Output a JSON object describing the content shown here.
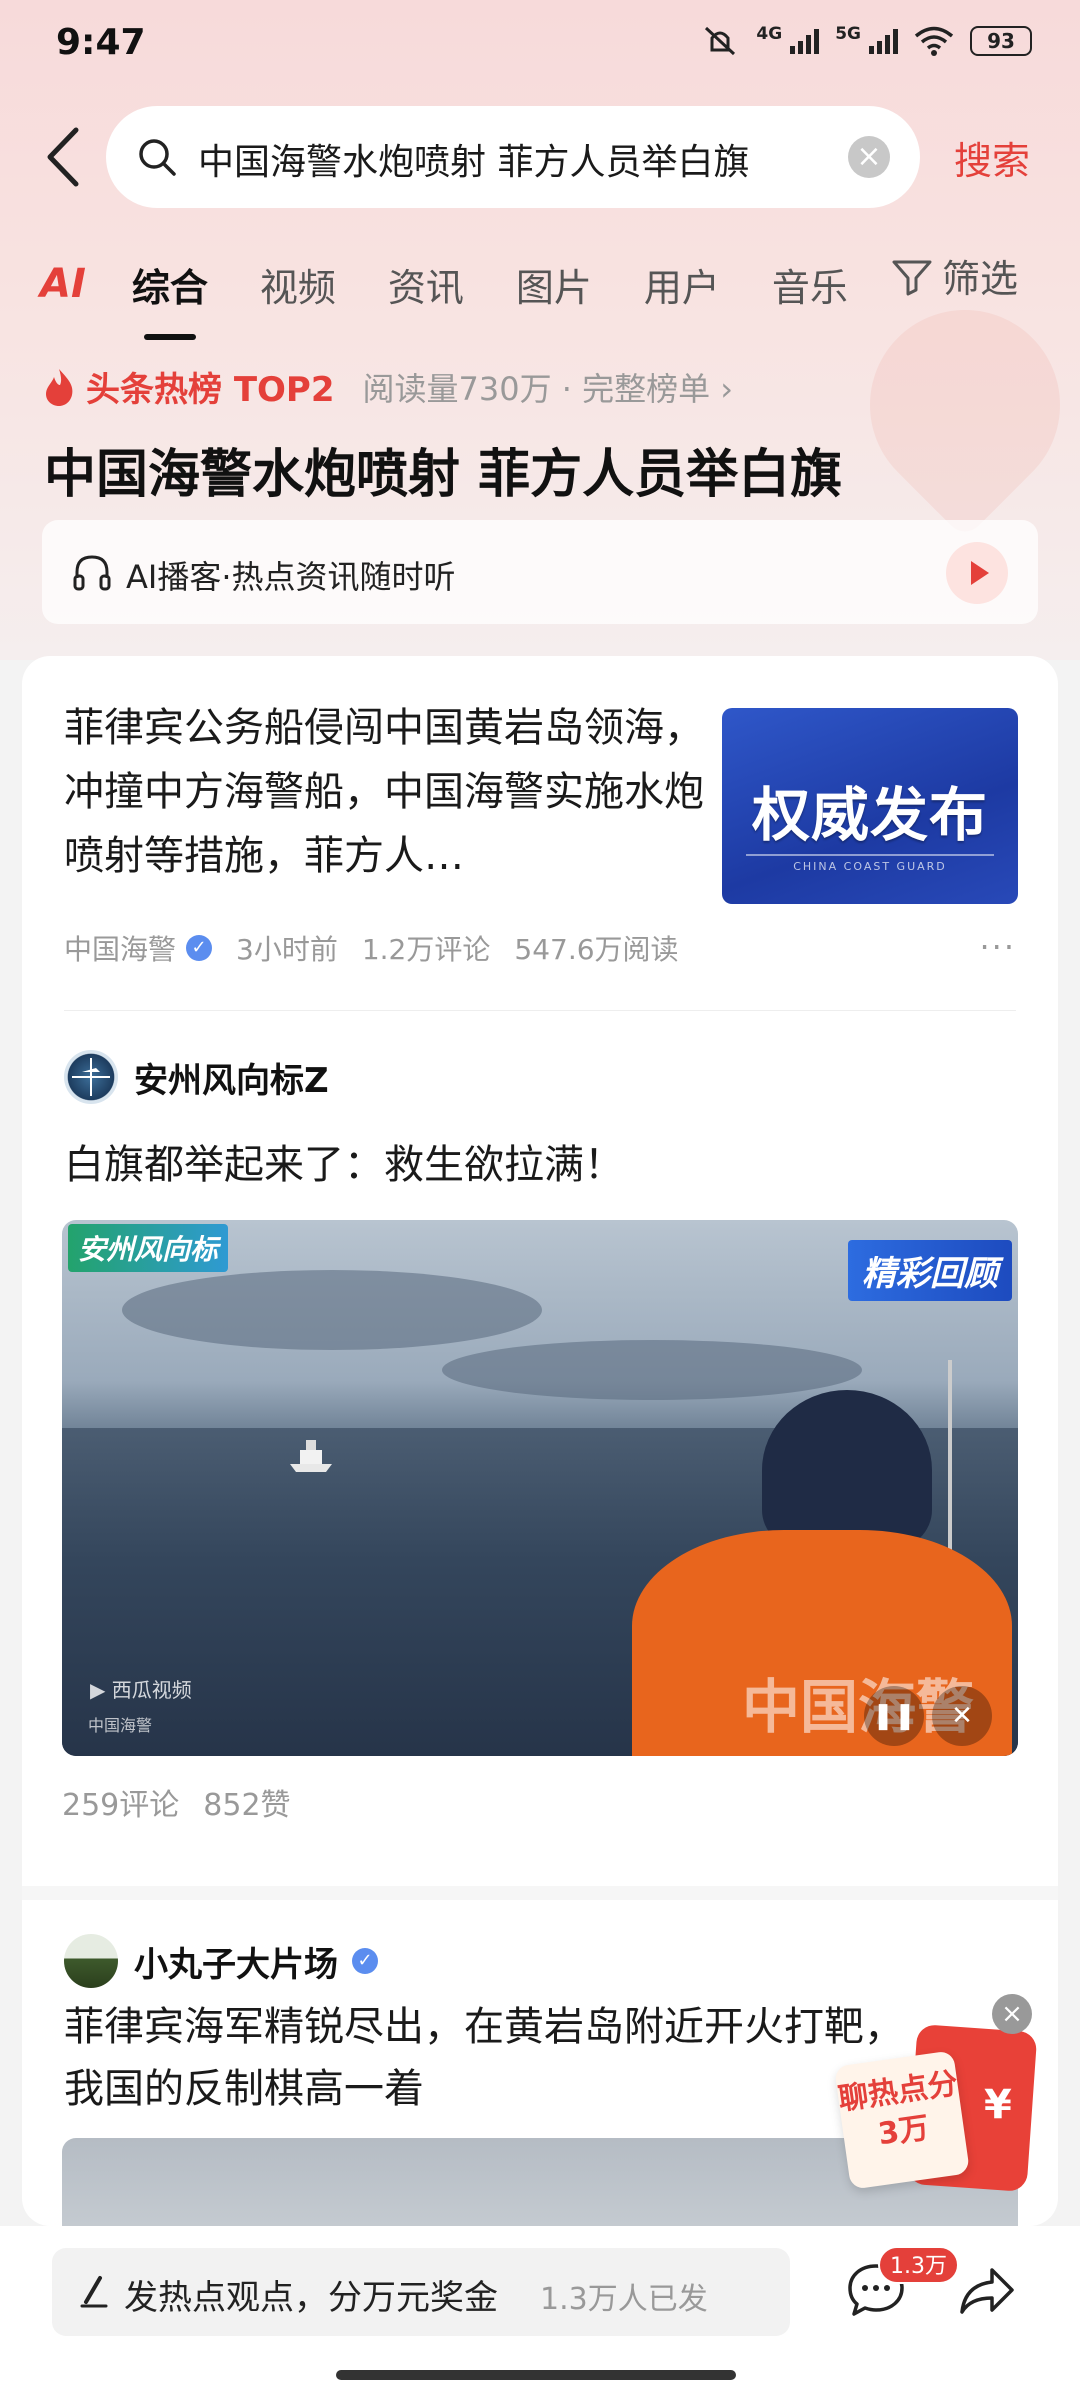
{
  "status_bar": {
    "time": "9:47",
    "net1": "4G",
    "net2": "5G",
    "battery": "93"
  },
  "search": {
    "query": "中国海警水炮喷射 菲方人员举白旗",
    "button_label": "搜索"
  },
  "tabs": {
    "ai_label": "AI",
    "items": [
      "综合",
      "视频",
      "资讯",
      "图片",
      "用户",
      "音乐"
    ],
    "active_index": 0,
    "filter_label": "筛选"
  },
  "hot": {
    "rank_label": "头条热榜 TOP2",
    "meta": "阅读量730万 · 完整榜单 ›",
    "headline": "中国海警水炮喷射 菲方人员举白旗"
  },
  "podcast": {
    "label": "AI播客·热点资讯随时听"
  },
  "article1": {
    "text": "菲律宾公务船侵闯中国黄岩岛领海，冲撞中方海警船，中国海警实施水炮喷射等措施，菲方人…",
    "thumb_title": "权威发布",
    "thumb_sub": "CHINA COAST GUARD",
    "source": "中国海警",
    "time": "3小时前",
    "comments": "1.2万评论",
    "reads": "547.6万阅读",
    "more": "···"
  },
  "post2": {
    "author": "安州风向标Z",
    "text": "白旗都举起来了：救生欲拉满！",
    "video_logo_left": "安州风向标",
    "video_logo_right": "精彩回顾",
    "video_watermark": "西瓜视频",
    "video_watermark2": "中国海警",
    "video_overlay": "中国海警",
    "comments": "259评论",
    "likes": "852赞"
  },
  "post3": {
    "author": "小丸子大片场",
    "text_line1": "菲律宾海军精锐尽出，在黄岩岛附近开火打靶，",
    "text_line2": "我国的反制棋高一着"
  },
  "red_packet": {
    "text": "聊热点分3万",
    "yen": "¥",
    "close": "×"
  },
  "bottom": {
    "comment_label": "发热点观点，分万元奖金",
    "comment_count": "1.3万人已发",
    "chat_badge": "1.3万"
  },
  "colors": {
    "accent": "#e4403a",
    "verified": "#5b8def"
  }
}
